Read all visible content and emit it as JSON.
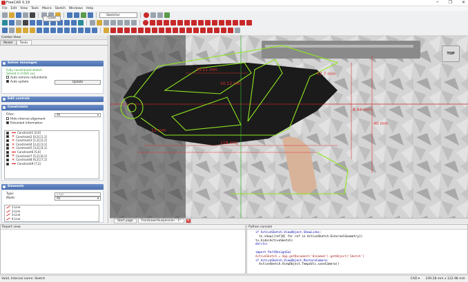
{
  "window": {
    "title": "FreeCAD 0.19",
    "minimize": "─",
    "maximize": "❐",
    "close": "✕"
  },
  "menu": [
    "File",
    "Edit",
    "View",
    "Tools",
    "Macro",
    "Sketch",
    "Windows",
    "Help"
  ],
  "workbench": {
    "label": "Sketcher"
  },
  "combo": {
    "title": "Combo View",
    "tabs": [
      "Model",
      "Tasks"
    ],
    "close_label": "Close"
  },
  "solver": {
    "title": "Solver messages",
    "msg1": "Fully constrained sketch",
    "msg2": "Solved in 0.001 sec",
    "auto_remove": "Auto remove redundants",
    "auto_update": "Auto update",
    "update_btn": "Update"
  },
  "edit_controls": {
    "title": "Edit controls"
  },
  "constraints": {
    "title": "Constraints",
    "filter_label": "Filter:",
    "filter_value": "All",
    "hide_internal": "Hide internal alignment",
    "extended": "Extended information",
    "items": [
      "Constraint1 [0,0]",
      "Constraint2 [0,2],[1,1]",
      "Constraint3 [1,2],[2,1]",
      "Constraint4 [2,2],[3,1]",
      "Constraint5 [3,2],[4,1]",
      "Constraint6 [5,0]",
      "Constraint7 [5,2],[6,1]",
      "Constraint8 [6,2],[7,1]",
      "Constraint9 [7,2]"
    ]
  },
  "elements": {
    "title": "Elements",
    "type_label": "Type:",
    "type_value": "Edge",
    "mode_label": "Mode:",
    "mode_value": "All",
    "items": [
      "1-Line",
      "2-Line",
      "3-Line",
      "4-Line"
    ]
  },
  "viewport": {
    "navcube": "TOP",
    "dims": [
      "29.21 mm",
      "10.12 mm",
      "118 mm",
      "8.44 mm",
      "40 mm",
      "13 mm",
      "47.7 mm"
    ]
  },
  "doc_tabs": [
    "Start page",
    "FrontLowerSuspension : 1*"
  ],
  "report": {
    "title": "Report view"
  },
  "python": {
    "title": "Python console",
    "lines": [
      "if ActiveSketch.ViewObject.ShowLinks:",
      "  tv.show([ref[0] for ref in ActiveSketch.ExternalGeometry])",
      "tv.hide(ActiveSketch)",
      "del(tv)",
      "",
      "import PartDesignGui",
      "ActiveSketch = App.getDocument('Unnamed').getObject('Sketch')",
      "if ActiveSketch.ViewObject.RestoreCamera:",
      "  ActiveSketch.ViewObject.TempoVis.saveCamera()"
    ]
  },
  "status": {
    "left": "Valid, Internal name: Sketch",
    "cad": "CAD",
    "dims": "239.28 mm x 122.98 mm"
  }
}
